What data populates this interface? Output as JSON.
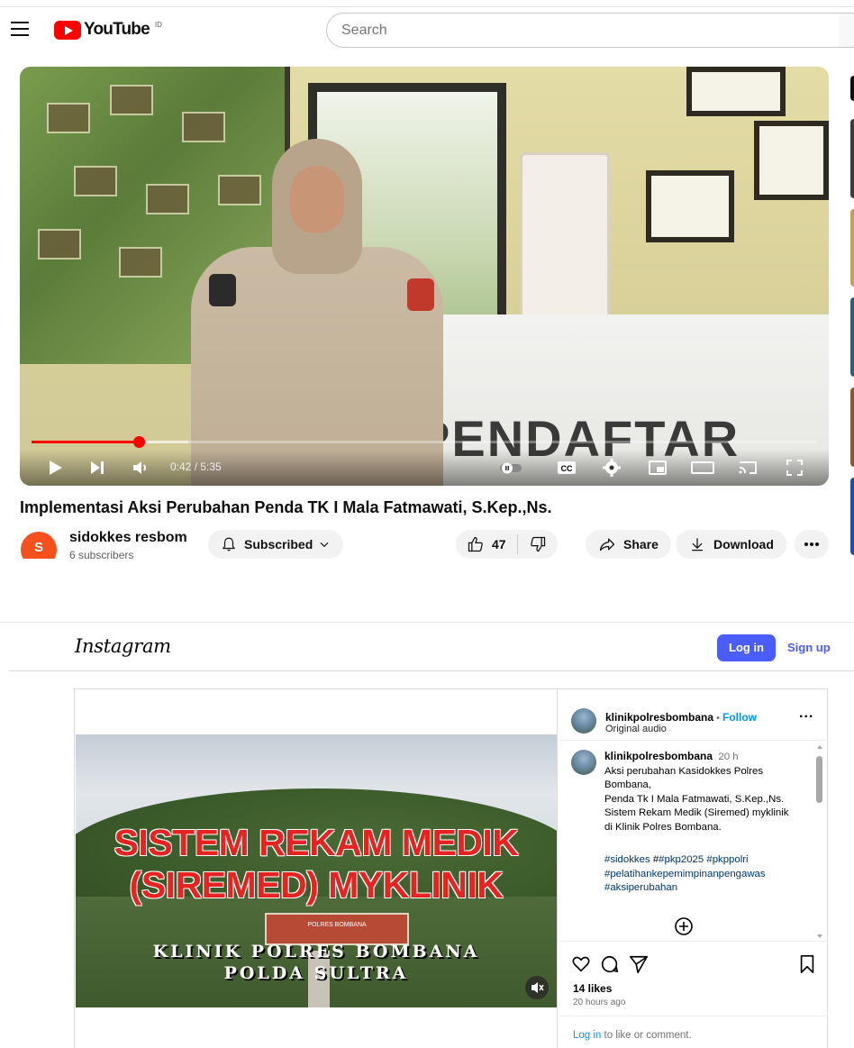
{
  "youtube": {
    "logo_text": "YouTube",
    "country_code": "ID",
    "search_placeholder": "Search",
    "player": {
      "time_display": "0:42 / 5:35",
      "progress_fraction": 0.137,
      "buffer_fraction": 0.2,
      "desk_text": "PENDAFTAR"
    },
    "title": "Implementasi Aksi Perubahan Penda TK I Mala Fatmawati, S.Kep.,Ns.",
    "channel": {
      "avatar_letter": "S",
      "name": "sidokkes resbom",
      "subscribers": "6 subscribers",
      "subscribe_label": "Subscribed"
    },
    "actions": {
      "likes": "47",
      "share_label": "Share",
      "download_label": "Download"
    }
  },
  "instagram": {
    "logo_text": "Instagram",
    "login_label": "Log in",
    "signup_label": "Sign up",
    "post": {
      "username": "klinikpolresbombana",
      "follow_separator": " • ",
      "follow_label": "Follow",
      "audio_label": "Original audio",
      "more_label": "...",
      "caption_username": "klinikpolresbombana",
      "caption_time": "20 h",
      "caption_lines": [
        "Aksi perubahan Kasidokkes Polres",
        "Bombana,",
        "Penda Tk I Mala Fatmawati, S.Kep.,Ns.",
        "Sistem Rekam Medik (Siremed) myklinik",
        "di Klinik Polres Bombana."
      ],
      "hashtag_line1_a": "#sidokkes",
      "hashtag_line1_b": " #",
      "hashtag_line1_c": "#pkp2025 #pkppolri",
      "hashtag_line2": "#pelatihankepemimpinanpengawas",
      "hashtag_line3": "#aksiperubahan",
      "likes_text": "14 likes",
      "time_ago": "20 hours ago",
      "login_link": "Log in",
      "comment_prompt": " to like or comment."
    },
    "video_overlay": {
      "line1": "SISTEM REKAM MEDIK",
      "line2": "(SIREMED) MYKLINIK",
      "line3": "KLINIK POLRES BOMBANA",
      "line4": "POLDA SULTRA",
      "sign_text": "POLRES    BOMBANA"
    }
  },
  "colors": {
    "youtube_red": "#ff0000",
    "instagram_blue": "#4a5df9",
    "link_blue": "#0095f6",
    "overlay_red": "#e52422"
  }
}
